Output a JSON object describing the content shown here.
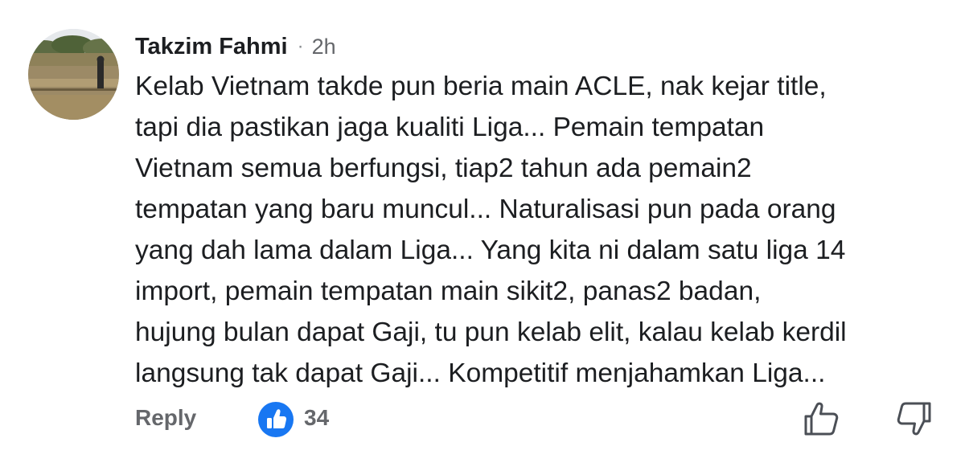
{
  "comment": {
    "author": "Takzim Fahmi",
    "separator": "·",
    "time": "2h",
    "lines": [
      "Kelab Vietnam takde pun beria main ACLE, nak kejar title,",
      "tapi dia pastikan jaga kualiti Liga... Pemain tempatan",
      "Vietnam semua berfungsi, tiap2 tahun ada pemain2",
      "tempatan yang baru muncul... Naturalisasi pun pada orang",
      "yang dah lama dalam Liga... Yang kita ni dalam satu liga 14",
      "import, pemain tempatan main sikit2, panas2 badan,",
      "hujung bulan dapat Gaji, tu pun kelab elit, kalau kelab kerdil",
      "langsung tak dapat Gaji... Kompetitif menjahamkan Liga..."
    ]
  },
  "actions": {
    "reply_label": "Reply",
    "reaction_icon": "like-reaction-icon",
    "reaction_count": "34",
    "like_icon": "thumbs-up-outline-icon",
    "dislike_icon": "thumbs-down-outline-icon"
  },
  "colors": {
    "text": "#1c1e21",
    "muted": "#65676b",
    "like_blue": "#1877f2"
  }
}
